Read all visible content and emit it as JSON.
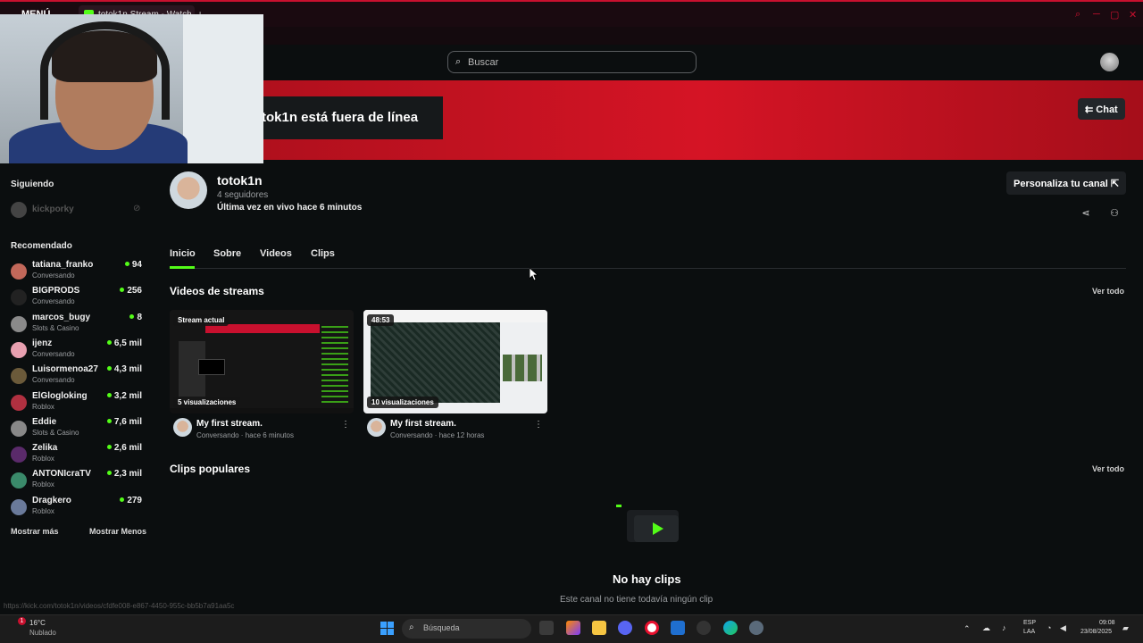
{
  "browser": {
    "menu_label": "MENÚ",
    "tab_title": "totok1n Stream - Watch L",
    "new_tab": "+"
  },
  "header": {
    "search_placeholder": "Buscar"
  },
  "banner": {
    "offline_text": "tok1n está fuera de línea",
    "chat_label": "Chat"
  },
  "sidebar": {
    "following_heading": "Siguiendo",
    "following": [
      {
        "name": "kickporky"
      }
    ],
    "recommended_heading": "Recomendado",
    "recommended": [
      {
        "name": "tatiana_franko",
        "category": "Conversando",
        "viewers": "94",
        "color": "#c2685a"
      },
      {
        "name": "BIGPRODS",
        "category": "Conversando",
        "viewers": "256",
        "color": "#222222"
      },
      {
        "name": "marcos_bugy",
        "category": "Slots & Casino",
        "viewers": "8",
        "color": "#8a8a8a"
      },
      {
        "name": "ijenz",
        "category": "Conversando",
        "viewers": "6,5 mil",
        "color": "#e8a0b0"
      },
      {
        "name": "Luisormenoa27",
        "category": "Conversando",
        "viewers": "4,3 mil",
        "color": "#6b5a3a"
      },
      {
        "name": "ElGlogloking",
        "category": "Roblox",
        "viewers": "3,2 mil",
        "color": "#b03040"
      },
      {
        "name": "Eddie",
        "category": "Slots & Casino",
        "viewers": "7,6 mil",
        "color": "#888888"
      },
      {
        "name": "Zelika",
        "category": "Roblox",
        "viewers": "2,6 mil",
        "color": "#5a2a6a"
      },
      {
        "name": "ANTONIcraTV",
        "category": "Roblox",
        "viewers": "2,3 mil",
        "color": "#3a8a6a"
      },
      {
        "name": "Dragkero",
        "category": "Roblox",
        "viewers": "279",
        "color": "#6a7a9a"
      }
    ],
    "show_more": "Mostrar más",
    "show_less": "Mostrar Menos"
  },
  "channel": {
    "name": "totok1n",
    "followers": "4 seguidores",
    "last_live": "Última vez en vivo hace 6 minutos",
    "customize_label": "Personaliza tu canal"
  },
  "tabs": [
    "Inicio",
    "Sobre",
    "Videos",
    "Clips"
  ],
  "videos_section": {
    "title": "Videos de streams",
    "see_all": "Ver todo",
    "videos": [
      {
        "badge": "Stream actual",
        "views": "5 visualizaciones",
        "title": "My first stream.",
        "meta": "Conversando · hace 6 minutos"
      },
      {
        "badge": "48:53",
        "views": "10 visualizaciones",
        "title": "My first stream.",
        "meta": "Conversando · hace 12 horas"
      }
    ]
  },
  "clips_section": {
    "title": "Clips populares",
    "see_all": "Ver todo",
    "empty_title": "No hay clips",
    "empty_sub": "Este canal no tiene todavía ningún clip"
  },
  "status_url": "https://kick.com/totok1n/videos/cfdfe008-e867-4450-955c-bb5b7a91aa5c",
  "taskbar": {
    "weather_temp": "16°C",
    "weather_desc": "Nublado",
    "notif_count": "1",
    "search_placeholder": "Búsqueda",
    "lang_top": "ESP",
    "lang_bottom": "LAA",
    "time": "09:08",
    "date": "23/08/2025"
  },
  "colors": {
    "accent": "#53fc18",
    "brand_red": "#d51425"
  }
}
